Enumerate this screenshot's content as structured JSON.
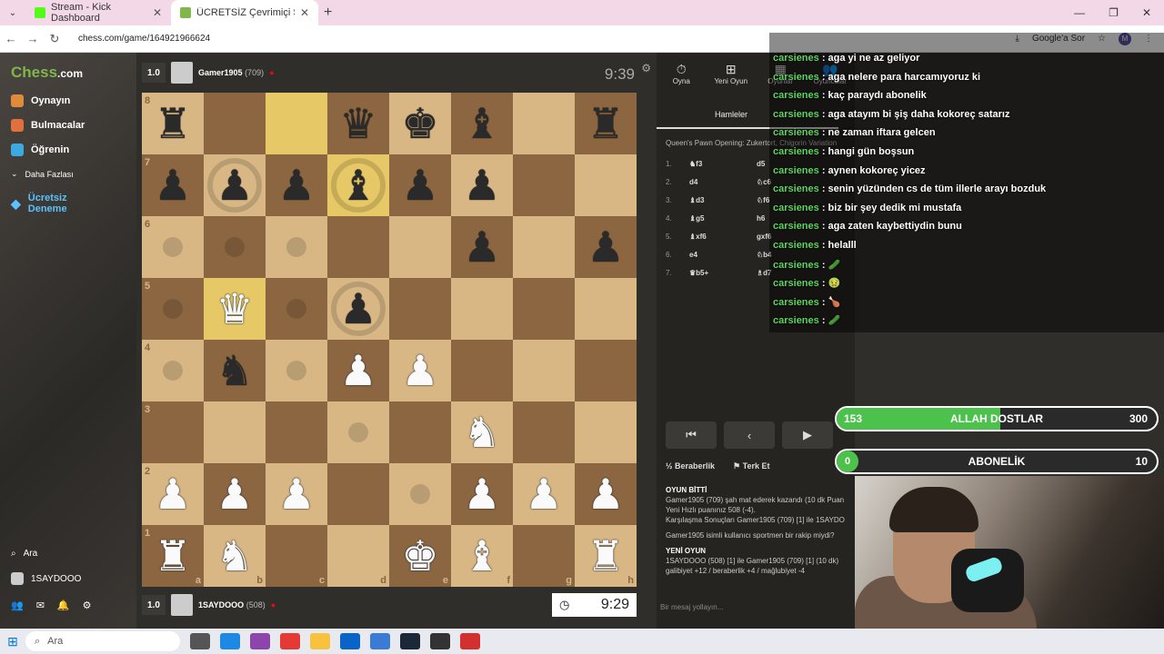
{
  "browser": {
    "tabs": [
      {
        "title": "Stream - Kick Dashboard",
        "color": "#53fc18"
      },
      {
        "title": "ÜCRETSİZ Çevrimiçi Satranç",
        "color": "#81b64c"
      }
    ],
    "url": "chess.com/game/164921966624",
    "google_label": "Google'a Sor",
    "profile_initial": "M"
  },
  "sidebar": {
    "logo_main": "Chess",
    "logo_suffix": ".com",
    "items": [
      {
        "label": "Oynayın",
        "color": "#e08a3c"
      },
      {
        "label": "Bulmacalar",
        "color": "#e0703c"
      },
      {
        "label": "Öğrenin",
        "color": "#3caae0"
      },
      {
        "label": "Daha Fazlası",
        "color": "#888888"
      },
      {
        "label": "Ücretsiz Deneme",
        "color": "#5ac2ff"
      }
    ],
    "search": "Ara",
    "user": "1SAYDOOO"
  },
  "players": {
    "top": {
      "name": "Gamer1905",
      "rating": "(709)",
      "score": "1.0",
      "clock": "9:39"
    },
    "bottom": {
      "name": "1SAYDOOO",
      "rating": "(508)",
      "score": "1.0",
      "clock": "9:29"
    }
  },
  "board": {
    "ranks": [
      "8",
      "7",
      "6",
      "5",
      "4",
      "3",
      "2",
      "1"
    ],
    "files": [
      "a",
      "b",
      "c",
      "d",
      "e",
      "f",
      "g",
      "h"
    ],
    "pieces": {
      "a8": "bR",
      "d8": "bQ",
      "e8": "bK",
      "f8": "bB",
      "h8": "bR",
      "a7": "bP",
      "b7": "bP",
      "c7": "bP",
      "d7": "bB",
      "e7": "bP",
      "f7": "bP",
      "f6": "bP",
      "h6": "bP",
      "b5": "wQ",
      "d5": "bP",
      "b4": "bN",
      "d4": "wP",
      "e4": "wP",
      "f3": "wN",
      "a2": "wP",
      "b2": "wP",
      "c2": "wP",
      "f2": "wP",
      "g2": "wP",
      "h2": "wP",
      "a1": "wR",
      "b1": "wN",
      "e1": "wK",
      "f1": "wB",
      "h1": "wR"
    },
    "highlight": [
      "c8",
      "d7",
      "b5"
    ],
    "dots": [
      "a6",
      "b6",
      "c6",
      "a5",
      "c5",
      "a4",
      "c4",
      "d3",
      "e2"
    ],
    "rings": [
      "b7",
      "d7",
      "d5"
    ]
  },
  "panel": {
    "tabs": [
      "Oyna",
      "Yeni Oyun",
      "Oyunlar",
      "Oyuncular"
    ],
    "moves_label": "Hamleler",
    "opening": "Queen's Pawn Opening: Zukertort, Chigorin Variation",
    "moves": [
      {
        "n": "1.",
        "w": "♞f3",
        "b": "d5"
      },
      {
        "n": "2.",
        "w": "d4",
        "b": "♘c6"
      },
      {
        "n": "3.",
        "w": "♝d3",
        "b": "♘f6"
      },
      {
        "n": "4.",
        "w": "♝g5",
        "b": "h6"
      },
      {
        "n": "5.",
        "w": "♝xf6",
        "b": "gxf6"
      },
      {
        "n": "6.",
        "w": "e4",
        "b": "♘b4"
      },
      {
        "n": "7.",
        "w": "♛b5+",
        "b": "♗d7"
      }
    ],
    "draw": "Beraberlik",
    "resign": "Terk Et",
    "log": [
      "OYUN BİTTİ",
      "Gamer1905 (709) şah mat ederek kazandı (10 dk Puan",
      "Yeni Hızlı puanınız 508 (-4).",
      "Karşılaşma Sonuçları Gamer1905 (709) [1] ile 1SAYDO",
      "Gamer1905 isimli kullanıcı sportmen bir rakip miydi?",
      "YENİ OYUN",
      "1SAYDOOO (508) [1] ile Gamer1905 (709) [1] (10 dk)",
      "galibiyet +12 / beraberlik +4 / mağlubiyet -4"
    ],
    "message_placeholder": "Bir mesaj yollayın..."
  },
  "chat": [
    {
      "user": "carsienes",
      "text": "aga yi ne az geliyor"
    },
    {
      "user": "carsienes",
      "text": "aga nelere para harcamıyoruz ki"
    },
    {
      "user": "carsienes",
      "text": "kaç paraydı abonelik"
    },
    {
      "user": "carsienes",
      "text": "aga atayım bi şiş daha kokoreç satarız"
    },
    {
      "user": "carsienes",
      "text": "ne zaman iftara gelcen"
    },
    {
      "user": "carsienes",
      "text": "hangi gün boşsun"
    },
    {
      "user": "carsienes",
      "text": "aynen kokoreç yicez"
    },
    {
      "user": "carsienes",
      "text": "senin yüzünden cs de tüm illerle arayı bozduk"
    },
    {
      "user": "carsienes",
      "text": "biz bir şey dedik mi mustafa"
    },
    {
      "user": "carsienes",
      "text": "aga zaten kaybettiydin bunu"
    },
    {
      "user": "carsienes",
      "text": "helalll"
    },
    {
      "user": "carsienes",
      "text": "🥒"
    },
    {
      "user": "carsienes",
      "text": "🤢"
    },
    {
      "user": "carsienes",
      "text": "🍗"
    },
    {
      "user": "carsienes",
      "text": "🥒"
    }
  ],
  "goals": [
    {
      "label": "ALLAH DOSTLAR",
      "current": "153",
      "target": "300",
      "fraction": 0.51
    },
    {
      "label": "ABONELİK",
      "current": "0",
      "target": "10",
      "fraction": 0
    }
  ],
  "taskbar": {
    "search": "Ara"
  }
}
